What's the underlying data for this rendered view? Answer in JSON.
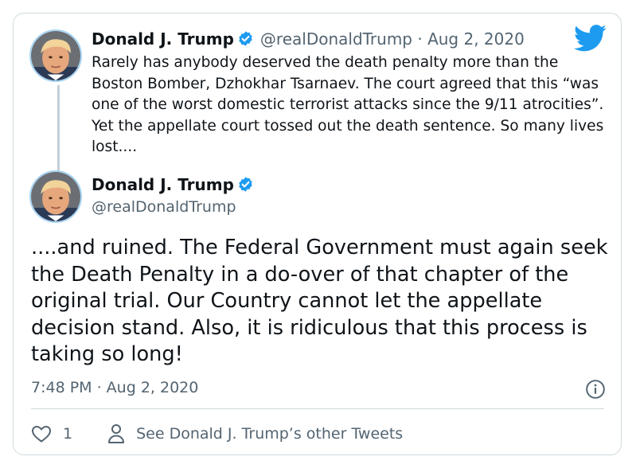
{
  "quoted": {
    "name": "Donald J. Trump",
    "handle": "@realDonaldTrump",
    "separator": "·",
    "date": "Aug 2, 2020",
    "text": "Rarely has anybody deserved the death penalty more than the Boston Bomber, Dzhokhar Tsarnaev. The court agreed that this “was one of the worst domestic terrorist attacks since the 9/11 atrocities”. Yet the appellate court tossed out the death sentence. So many lives lost...."
  },
  "main": {
    "name": "Donald J. Trump",
    "handle": "@realDonaldTrump",
    "text": "....and ruined. The Federal Government must again seek the Death Penalty in a do-over of that chapter of the original trial. Our Country cannot let the appellate decision stand. Also, it is ridiculous that this process is taking so long!",
    "timestamp": "7:48 PM · Aug 2, 2020"
  },
  "actions": {
    "likes": "1",
    "other_tweets_label": "See Donald J. Trump’s other Tweets"
  },
  "icons": {
    "brand": "twitter-bird-icon",
    "verified": "verified-badge-icon",
    "info": "info-icon",
    "like": "heart-icon",
    "profile": "person-icon"
  },
  "colors": {
    "brand_blue": "#1d9bf0",
    "text": "#0f1419",
    "muted": "#536471",
    "border": "#cfd9de"
  }
}
